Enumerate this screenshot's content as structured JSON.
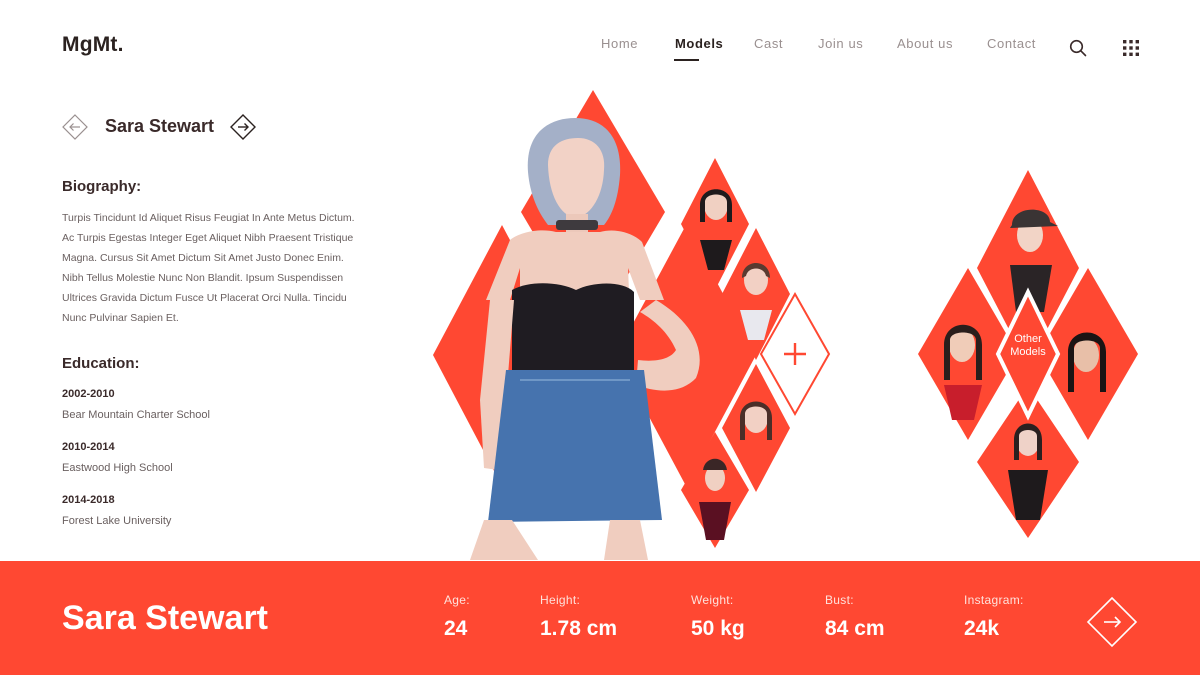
{
  "brand": {
    "logo": "MgMt."
  },
  "nav": {
    "items": [
      {
        "label": "Home"
      },
      {
        "label": "Models"
      },
      {
        "label": "Cast"
      },
      {
        "label": "Join us"
      },
      {
        "label": "About us"
      },
      {
        "label": "Contact"
      }
    ],
    "active": "Models",
    "icons": [
      "search-icon",
      "grid-menu-icon"
    ]
  },
  "profile": {
    "name": "Sara Stewart",
    "prev_icon": "arrow-left-icon",
    "next_icon": "arrow-right-icon"
  },
  "biography": {
    "title": "Biography:",
    "lines": [
      "Turpis Tincidunt Id Aliquet Risus Feugiat In Ante Metus Dictum.",
      "Ac Turpis Egestas Integer Eget Aliquet Nibh Praesent Tristique",
      "Magna. Cursus Sit Amet Dictum Sit Amet Justo Donec Enim.",
      "Nibh Tellus Molestie Nunc Non Blandit. Ipsum Suspendissen",
      "Ultrices Gravida Dictum Fusce Ut Placerat Orci Nulla. Tincidu",
      "Nunc Pulvinar Sapien Et."
    ]
  },
  "education": {
    "title": "Education:",
    "entries": [
      {
        "years": "2002-2010",
        "school": "Bear Mountain Charter School"
      },
      {
        "years": "2010-2014",
        "school": "Eastwood High School"
      },
      {
        "years": "2014-2018",
        "school": "Forest Lake University"
      }
    ]
  },
  "gallery": {
    "add_icon": "plus-icon",
    "other_models_line1": "Other",
    "other_models_line2": "Models"
  },
  "stats": {
    "name": "Sara Stewart",
    "items": [
      {
        "label": "Age:",
        "value": "24"
      },
      {
        "label": "Height:",
        "value": "1.78 cm"
      },
      {
        "label": "Weight:",
        "value": "50 kg"
      },
      {
        "label": "Bust:",
        "value": "84 cm"
      },
      {
        "label": "Instagram:",
        "value": "24k"
      }
    ],
    "next_icon": "arrow-right-icon"
  },
  "colors": {
    "accent": "#ff4832",
    "text_dark": "#2b2220",
    "text_muted": "#9a9090"
  }
}
